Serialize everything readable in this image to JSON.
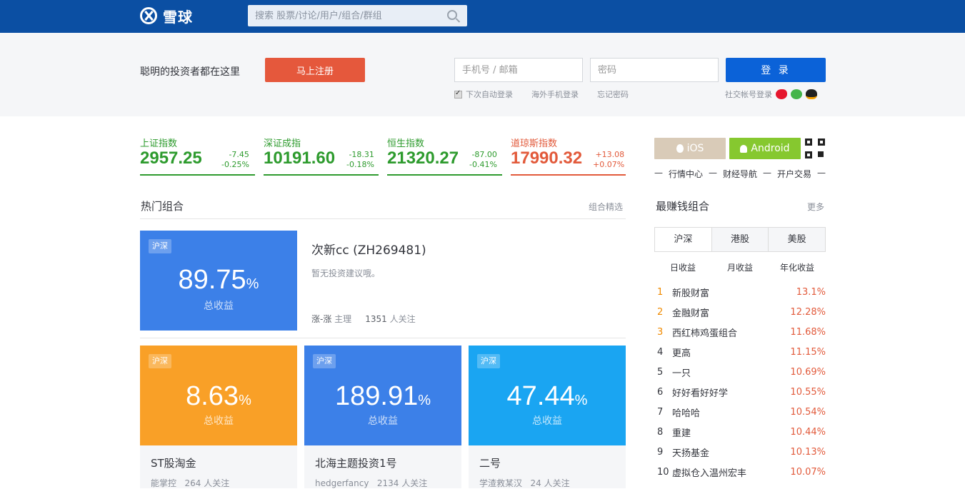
{
  "header": {
    "logo_text": "雪球",
    "search_placeholder": "搜索 股票/讨论/用户/组合/群组"
  },
  "login_band": {
    "slogan": "聪明的投资者都在这里",
    "register_label": "马上注册",
    "phone_placeholder": "手机号 / 邮箱",
    "password_placeholder": "密码",
    "login_label": "登 录",
    "auto_login": "下次自动登录",
    "overseas_login": "海外手机登录",
    "forgot_password": "忘记密码",
    "social_login": "社交帐号登录"
  },
  "indices": [
    {
      "name": "上证指数",
      "price": "2957.25",
      "change": "-7.45",
      "change_pct": "-0.25%",
      "direction": "down"
    },
    {
      "name": "深证成指",
      "price": "10191.60",
      "change": "-18.31",
      "change_pct": "-0.18%",
      "direction": "down"
    },
    {
      "name": "恒生指数",
      "price": "21320.27",
      "change": "-87.00",
      "change_pct": "-0.41%",
      "direction": "down"
    },
    {
      "name": "道琼斯指数",
      "price": "17990.32",
      "change": "+13.08",
      "change_pct": "+0.07%",
      "direction": "up"
    }
  ],
  "colors": {
    "down": "#2e9b2e",
    "up": "#e25a3b",
    "brand": "#0b4fa3"
  },
  "hot": {
    "title": "热门组合",
    "more": "组合精选",
    "featured": {
      "tag": "沪深",
      "return_value": "89.75",
      "return_unit": "%",
      "return_label": "总收益",
      "name": "次新cc (ZH269481)",
      "desc": "暂无投资建议哦。",
      "owner": "涨-涨",
      "owner_role": "主理",
      "followers": "1351",
      "followers_label": "人关注"
    },
    "cards": [
      {
        "tag": "沪深",
        "return_value": "8.63",
        "return_unit": "%",
        "return_label": "总收益",
        "name": "ST股淘金",
        "owner": "能掌控",
        "followers": "264",
        "followers_label": "人关注"
      },
      {
        "tag": "沪深",
        "return_value": "189.91",
        "return_unit": "%",
        "return_label": "总收益",
        "name": "北海主题投资1号",
        "owner": "hedgerfancy",
        "followers": "2134",
        "followers_label": "人关注"
      },
      {
        "tag": "沪深",
        "return_value": "47.44",
        "return_unit": "%",
        "return_label": "总收益",
        "name": "二号",
        "owner": "学渣救某汉",
        "followers": "24",
        "followers_label": "人关注"
      }
    ]
  },
  "apps": {
    "ios": "iOS",
    "android": "Android",
    "links": [
      "—",
      "行情中心",
      "—",
      "财经导航",
      "—",
      "开户交易",
      "—"
    ]
  },
  "top_earning": {
    "title": "最赚钱组合",
    "more": "更多",
    "tabs": [
      "沪深",
      "港股",
      "美股"
    ],
    "subtabs": [
      "日收益",
      "月收益",
      "年化收益"
    ],
    "rows": [
      {
        "rank": "1",
        "name": "新股财富",
        "value": "13.1%"
      },
      {
        "rank": "2",
        "name": "金融财富",
        "value": "12.28%"
      },
      {
        "rank": "3",
        "name": "西红柿鸡蛋组合",
        "value": "11.68%"
      },
      {
        "rank": "4",
        "name": "更高",
        "value": "11.15%"
      },
      {
        "rank": "5",
        "name": "一只",
        "value": "10.69%"
      },
      {
        "rank": "6",
        "name": "好好看好好学",
        "value": "10.55%"
      },
      {
        "rank": "7",
        "name": "哈哈哈",
        "value": "10.54%"
      },
      {
        "rank": "8",
        "name": "重建",
        "value": "10.44%"
      },
      {
        "rank": "9",
        "name": "天扬基金",
        "value": "10.13%"
      },
      {
        "rank": "10",
        "name": "虚拟仓入温州宏丰",
        "value": "10.07%"
      }
    ]
  }
}
